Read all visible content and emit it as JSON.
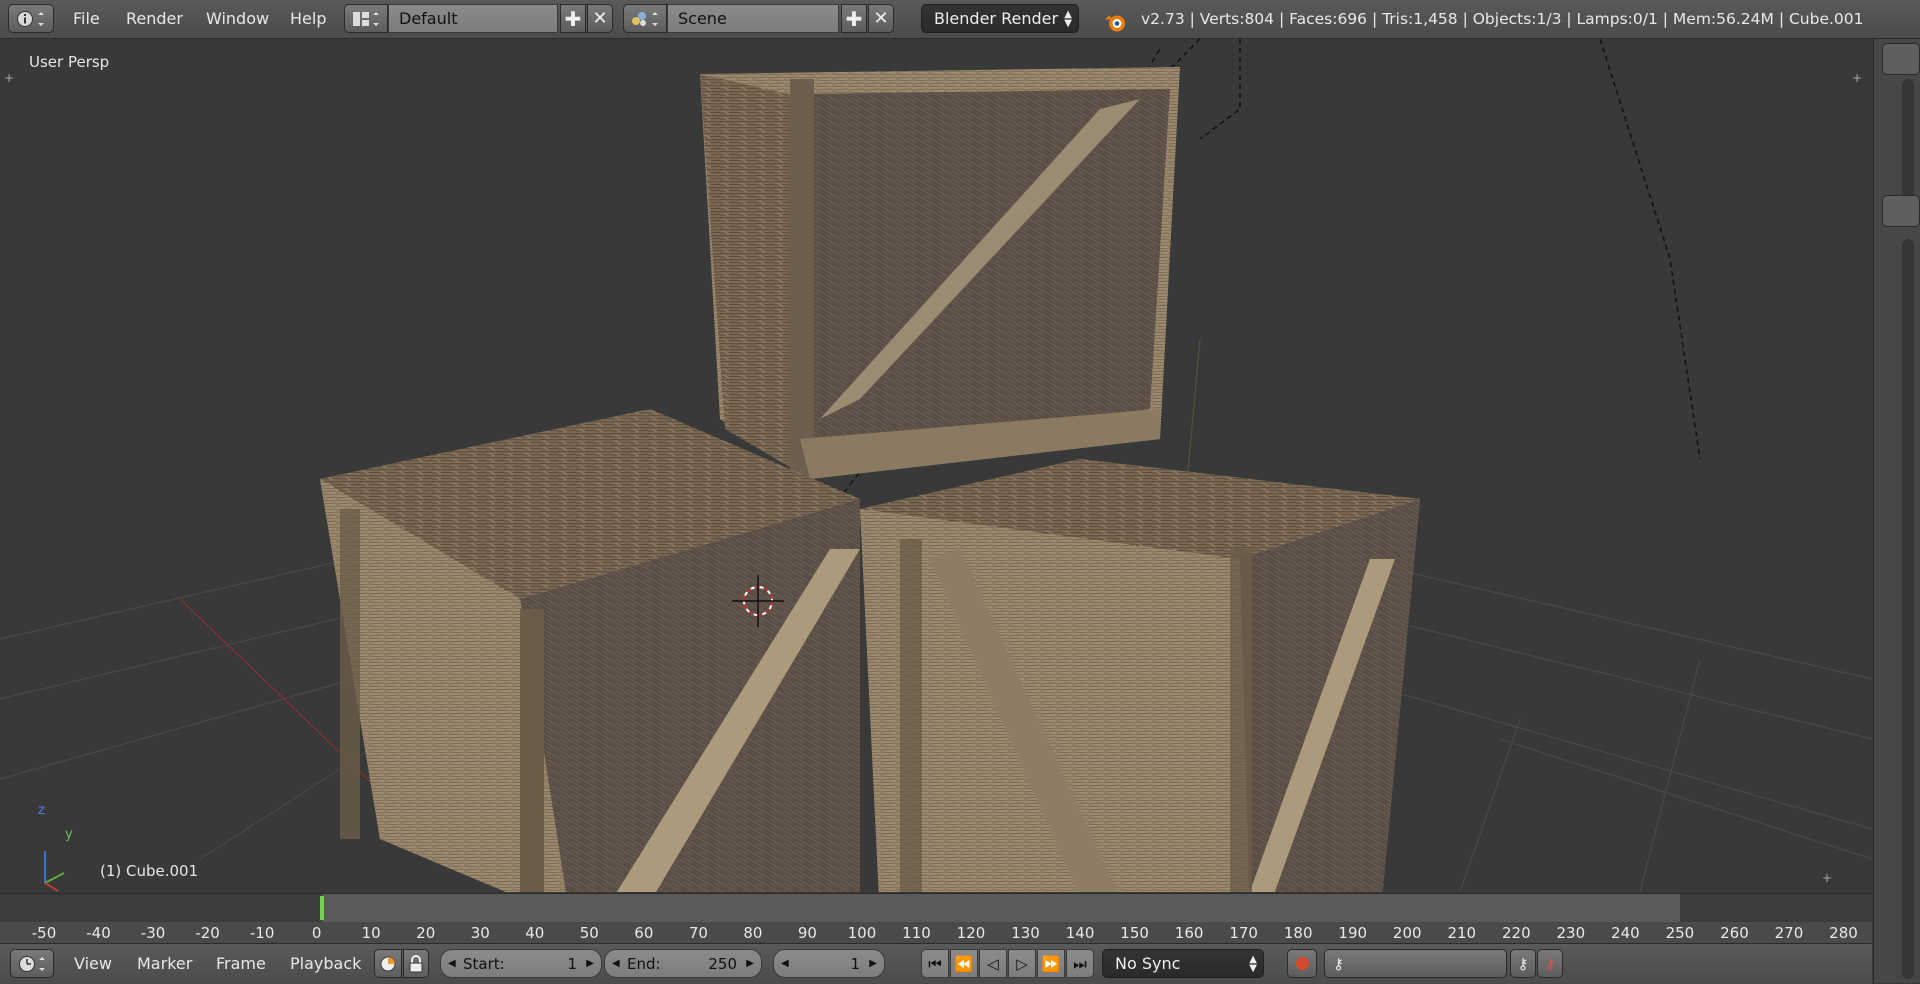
{
  "topbar": {
    "menu": [
      "File",
      "Render",
      "Window",
      "Help"
    ],
    "layout_value": "Default",
    "scene_value": "Scene",
    "engine_value": "Blender Render",
    "stats": "v2.73 | Verts:804 | Faces:696 | Tris:1,458 | Objects:1/3 | Lamps:0/1 | Mem:56.24M | Cube.001"
  },
  "viewport": {
    "view_label": "User Persp",
    "object_label": "(1) Cube.001",
    "axis_labels": {
      "z": "z",
      "y": "y"
    }
  },
  "timeline": {
    "ticks": [
      "-50",
      "-40",
      "-30",
      "-20",
      "-10",
      "0",
      "10",
      "20",
      "30",
      "40",
      "50",
      "60",
      "70",
      "80",
      "90",
      "100",
      "110",
      "120",
      "130",
      "140",
      "150",
      "160",
      "170",
      "180",
      "190",
      "200",
      "210",
      "220",
      "230",
      "240",
      "250",
      "260",
      "270",
      "280"
    ],
    "current_frame": 1,
    "range_start": 1,
    "range_end": 250
  },
  "bottombar": {
    "menu": [
      "View",
      "Marker",
      "Frame",
      "Playback"
    ],
    "start_label": "Start:",
    "start_value": "1",
    "end_label": "End:",
    "end_value": "250",
    "current_value": "1",
    "sync_value": "No Sync"
  },
  "colors": {
    "accent_green": "#6fd24a",
    "record_red": "#d44a2a",
    "x_axis": "#a84040",
    "y_axis": "#6e9e3a"
  }
}
